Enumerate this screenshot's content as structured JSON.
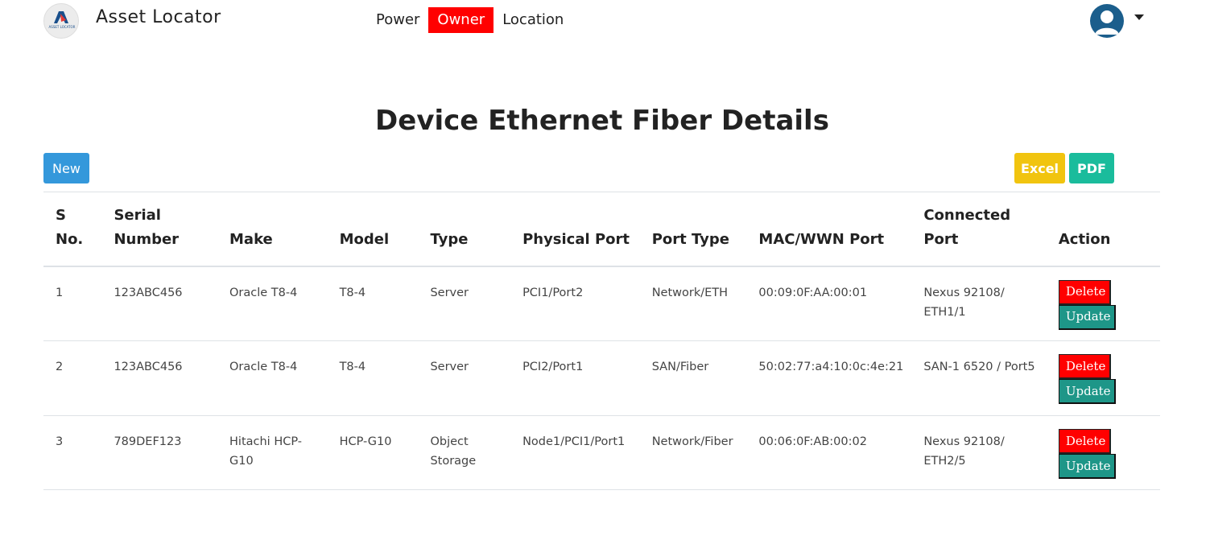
{
  "app": {
    "brand": "Asset Locator",
    "logo_text": "ASSET LOCATOR"
  },
  "nav": {
    "items": [
      {
        "label": "Power",
        "active": false
      },
      {
        "label": "Owner",
        "active": true
      },
      {
        "label": "Location",
        "active": false
      }
    ]
  },
  "page": {
    "title": "Device Ethernet Fiber Details"
  },
  "toolbar": {
    "new_label": "New",
    "excel_label": "Excel",
    "pdf_label": "PDF"
  },
  "table": {
    "headers": {
      "sno": [
        "S",
        "No."
      ],
      "serial": [
        "Serial",
        "Number"
      ],
      "make": "Make",
      "model": "Model",
      "type": "Type",
      "physical_port": "Physical Port",
      "port_type": "Port Type",
      "mac": "MAC/WWN Port",
      "connected": [
        "Connected",
        "Port"
      ],
      "action": "Action"
    },
    "rows": [
      {
        "sno": "1",
        "serial": "123ABC456",
        "make": "Oracle T8-4",
        "model": "T8-4",
        "type": "Server",
        "physical_port": "PCI1/Port2",
        "port_type": "Network/ETH",
        "mac": "00:09:0F:AA:00:01",
        "connected": "Nexus 92108/ ETH1/1",
        "delete_label": "Delete",
        "update_label": "Update"
      },
      {
        "sno": "2",
        "serial": "123ABC456",
        "make": "Oracle T8-4",
        "model": "T8-4",
        "type": "Server",
        "physical_port": "PCI2/Port1",
        "port_type": "SAN/Fiber",
        "mac": "50:02:77:a4:10:0c:4e:21",
        "connected": "SAN-1 6520 / Port5",
        "delete_label": "Delete",
        "update_label": "Update"
      },
      {
        "sno": "3",
        "serial": "789DEF123",
        "make": "Hitachi HCP-G10",
        "model": "HCP-G10",
        "type": "Object Storage",
        "physical_port": "Node1/PCI1/Port1",
        "port_type": "Network/Fiber",
        "mac": "00:06:0F:AB:00:02",
        "connected": "Nexus 92108/ ETH2/5",
        "delete_label": "Delete",
        "update_label": "Update"
      }
    ]
  },
  "colors": {
    "active_nav": "#ff0000",
    "new_button": "#3498db",
    "excel_button": "#f1c40f",
    "pdf_button": "#1abc9c",
    "delete_button": "#ff0000",
    "update_button": "#1e9688",
    "avatar": "#1b5e8c"
  },
  "icons": {
    "logo": "asset-locator-logo",
    "user": "user-avatar-icon",
    "menu": "caret-down-icon"
  }
}
